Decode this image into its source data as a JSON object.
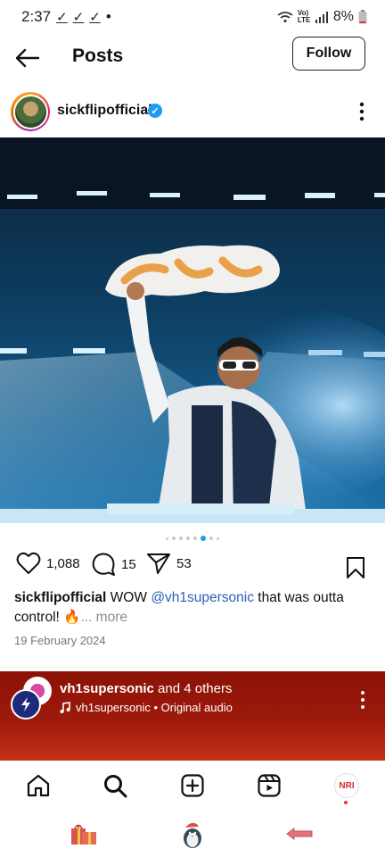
{
  "status_bar": {
    "time": "2:37",
    "check_icons": [
      "✓",
      "✓",
      "✓"
    ],
    "dot": "•",
    "network_label": "Vo) LTE",
    "battery": "8%"
  },
  "header": {
    "title": "Posts",
    "follow_label": "Follow"
  },
  "author": {
    "username": "sickflipofficial",
    "verified_mark": "✓"
  },
  "carousel": {
    "count": 8,
    "active_index": 5
  },
  "actions": {
    "likes": "1,088",
    "comments": "15",
    "shares": "53"
  },
  "caption": {
    "username": "sickflipofficial",
    "text_1": " WOW ",
    "mention": "@vh1supersonic",
    "text_2": " that was outta control! 🔥",
    "more": "... more"
  },
  "date": "19 February 2024",
  "audio": {
    "account": "vh1supersonic",
    "others": " and 4 others",
    "subtitle": "vh1supersonic • Original audio"
  },
  "nav": {
    "profile_initials": "NRI"
  },
  "colors": {
    "accent_blue": "#1d9bf0",
    "mention_blue": "#2b5fb8",
    "audio_banner": "#9e1a0c"
  },
  "icons": {
    "back": "arrow-left-icon",
    "more": "more-vertical-icon",
    "like": "heart-icon",
    "comment": "comment-icon",
    "share": "send-icon",
    "save": "bookmark-icon",
    "home": "home-icon",
    "search": "search-icon",
    "create": "plus-square-icon",
    "reels": "reels-icon"
  }
}
